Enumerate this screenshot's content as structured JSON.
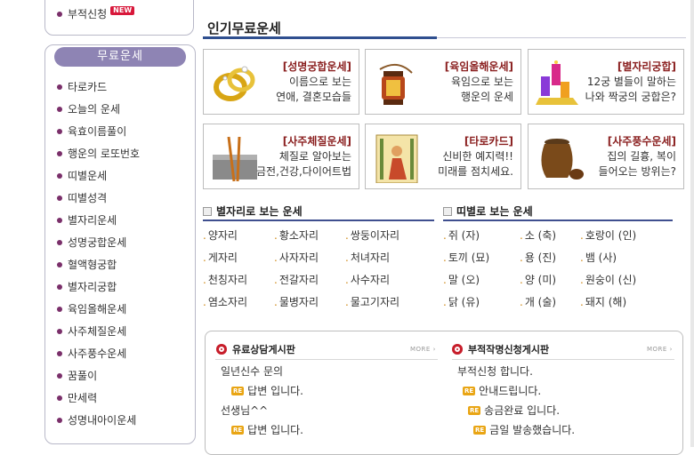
{
  "sidebar": {
    "top_item": {
      "label": "부적신청",
      "badge": "NEW"
    },
    "section_title": "무료운세",
    "items": [
      {
        "label": "타로카드"
      },
      {
        "label": "오늘의 운세"
      },
      {
        "label": "육효이름풀이"
      },
      {
        "label": "행운의 로또번호"
      },
      {
        "label": "띠별운세"
      },
      {
        "label": "띠별성격"
      },
      {
        "label": "별자리운세"
      },
      {
        "label": "성명궁합운세"
      },
      {
        "label": "혈액형궁합"
      },
      {
        "label": "별자리궁합"
      },
      {
        "label": "육임올해운세"
      },
      {
        "label": "사주체질운세"
      },
      {
        "label": "사주풍수운세"
      },
      {
        "label": "꿈풀이"
      },
      {
        "label": "만세력"
      },
      {
        "label": "성명내아이운세"
      }
    ]
  },
  "main": {
    "title": "인기무료운세",
    "cards": [
      {
        "title": "[성명궁합운세]",
        "desc1": "이름으로 보는",
        "desc2": "연애, 결혼모습들",
        "icon": "rings-icon"
      },
      {
        "title": "[육임올해운세]",
        "desc1": "육임으로 보는",
        "desc2": "행운의 운세",
        "icon": "lantern-icon"
      },
      {
        "title": "[별자리궁합]",
        "desc1": "12궁 별들이 말하는",
        "desc2": "나와 짝궁의 궁합은?",
        "icon": "candles-icon"
      },
      {
        "title": "[사주체질운세]",
        "desc1": "체질로 알아보는",
        "desc2": "금전,건강,다이어트법",
        "icon": "chopsticks-icon"
      },
      {
        "title": "[타로카드]",
        "desc1": "신비한 예지력!!",
        "desc2": "미래를 점치세요.",
        "icon": "tarot-card-icon"
      },
      {
        "title": "[사주풍수운세]",
        "desc1": "집의 길흉, 복이",
        "desc2": "들어오는 방위는?",
        "icon": "jar-icon"
      }
    ],
    "zodiac": {
      "header": "별자리로 보는 운세",
      "items": [
        "양자리",
        "황소자리",
        "쌍둥이자리",
        "게자리",
        "사자자리",
        "처녀자리",
        "천칭자리",
        "전갈자리",
        "사수자리",
        "염소자리",
        "물병자리",
        "물고기자리"
      ]
    },
    "animal": {
      "header": "띠별로 보는 운세",
      "items": [
        "쥐 (자)",
        "소 (축)",
        "호랑이 (인)",
        "토끼 (묘)",
        "용 (진)",
        "뱀 (사)",
        "말 (오)",
        "양 (미)",
        "원숭이 (신)",
        "닭 (유)",
        "개 (술)",
        "돼지 (해)"
      ]
    },
    "boards": [
      {
        "title": "유료상담게시판",
        "more": "MORE",
        "posts": [
          {
            "text": "일년신수 문의",
            "reply": false
          },
          {
            "text": "답변 입니다.",
            "reply": true
          },
          {
            "text": "선생님^^",
            "reply": false
          },
          {
            "text": "답변 입니다.",
            "reply": true
          }
        ]
      },
      {
        "title": "부적작명신청게시판",
        "more": "MORE",
        "posts": [
          {
            "text": "부적신청 합니다.",
            "reply": false
          },
          {
            "text": "안내드립니다.",
            "reply": true
          },
          {
            "text": "송금완료 입니다.",
            "reply": true
          },
          {
            "text": "금일 발송했습니다.",
            "reply": true
          }
        ]
      }
    ],
    "reply_badge": "RE"
  },
  "colors": {
    "accent": "#2f4f8f",
    "title_red": "#8a1f1f",
    "pill": "#8e84b4",
    "bullet": "#7a2f6a"
  }
}
